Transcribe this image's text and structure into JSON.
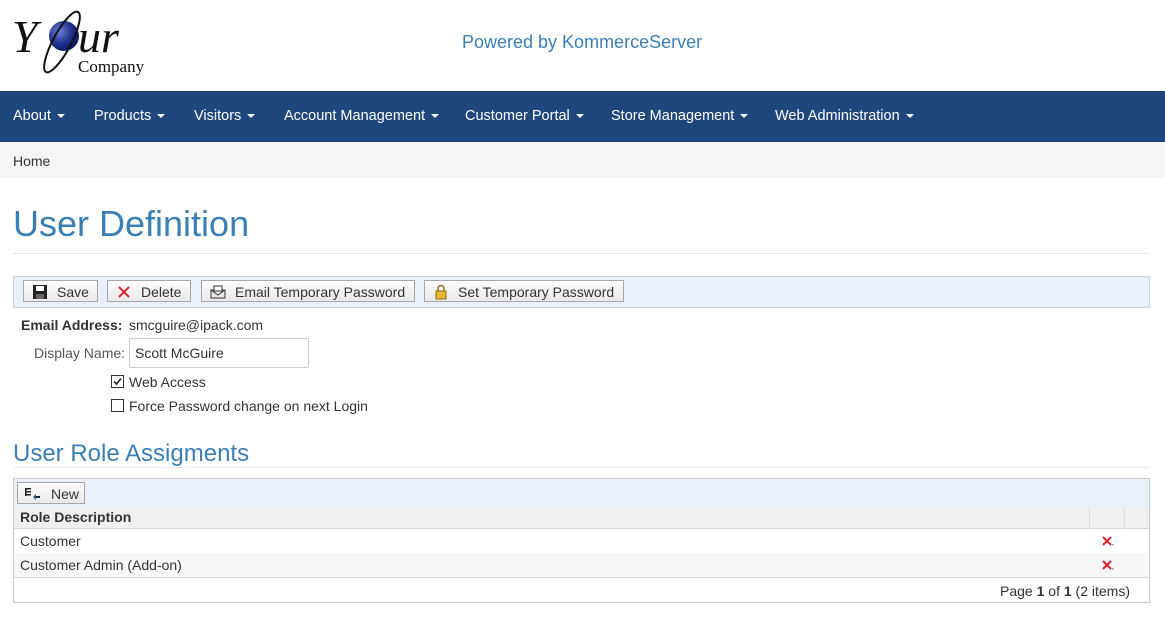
{
  "header": {
    "logo_main": "Your",
    "logo_sub": "Company",
    "powered_by": "Powered by KommerceServer"
  },
  "nav": {
    "items": [
      {
        "label": "About"
      },
      {
        "label": "Products"
      },
      {
        "label": "Visitors"
      },
      {
        "label": "Account Management"
      },
      {
        "label": "Customer Portal"
      },
      {
        "label": "Store Management"
      },
      {
        "label": "Web Administration"
      }
    ]
  },
  "breadcrumb": {
    "home": "Home"
  },
  "page": {
    "title": "User Definition"
  },
  "toolbar": {
    "save": "Save",
    "delete": "Delete",
    "email_temp_password": "Email Temporary Password",
    "set_temp_password": "Set Temporary Password"
  },
  "form": {
    "email_label": "Email Address:",
    "email_value": "smcguire@ipack.com",
    "display_name_label": "Display Name:",
    "display_name_value": "Scott McGuire",
    "web_access_label": "Web Access",
    "web_access_checked": true,
    "force_pw_label": "Force Password change on next Login",
    "force_pw_checked": false
  },
  "roles": {
    "section_title": "User Role Assigments",
    "new_button": "New",
    "column_header": "Role Description",
    "rows": [
      {
        "role": "Customer"
      },
      {
        "role": "Customer Admin (Add-on)"
      }
    ],
    "pager": {
      "page_word": "Page",
      "current": "1",
      "of_word": "of",
      "total": "1",
      "items": "(2 items)"
    }
  },
  "colors": {
    "navbar": "#1f477d",
    "title": "#3a7fb5",
    "toolbar_bg": "#eaf0f9",
    "delete_icon": "#d9252a"
  },
  "icons": {
    "save": "floppy-disk-icon",
    "delete": "red-x-icon",
    "email": "printer-envelope-icon",
    "set_password": "padlock-icon",
    "new": "new-record-icon",
    "row_delete": "red-x-icon"
  }
}
